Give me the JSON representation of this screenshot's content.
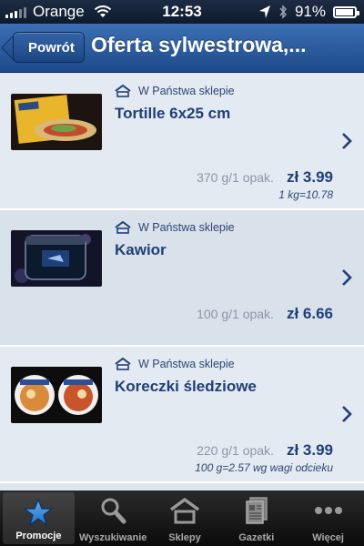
{
  "status_bar": {
    "carrier": "Orange",
    "time": "12:53",
    "battery": "91%",
    "battery_level": 0.91
  },
  "nav": {
    "back_label": "Powrót",
    "title": "Oferta sylwestrowa,..."
  },
  "items": [
    {
      "store_label": "W Państwa sklepie",
      "name": "Tortille 6x25 cm",
      "pack": "370 g/1 opak.",
      "price": "zł 3.99",
      "unit_price": "1 kg=10.78"
    },
    {
      "store_label": "W Państwa sklepie",
      "name": "Kawior",
      "pack": "100 g/1 opak.",
      "price": "zł 6.66",
      "unit_price": ""
    },
    {
      "store_label": "W Państwa sklepie",
      "name": "Koreczki śledziowe",
      "pack": "220 g/1 opak.",
      "price": "zł 3.99",
      "unit_price": "100 g=2.57 wg wagi odcieku"
    }
  ],
  "tabs": [
    {
      "label": "Promocje",
      "icon": "star-icon",
      "active": true
    },
    {
      "label": "Wyszukiwanie",
      "icon": "magnifier-icon",
      "active": false
    },
    {
      "label": "Sklepy",
      "icon": "store-icon",
      "active": false
    },
    {
      "label": "Gazetki",
      "icon": "newspaper-icon",
      "active": false
    },
    {
      "label": "Więcej",
      "icon": "more-dots-icon",
      "active": false
    }
  ],
  "colors": {
    "nav_blue": "#2a5a9e",
    "text_blue": "#1f3f78",
    "list_bg": "#e3eaf2"
  }
}
